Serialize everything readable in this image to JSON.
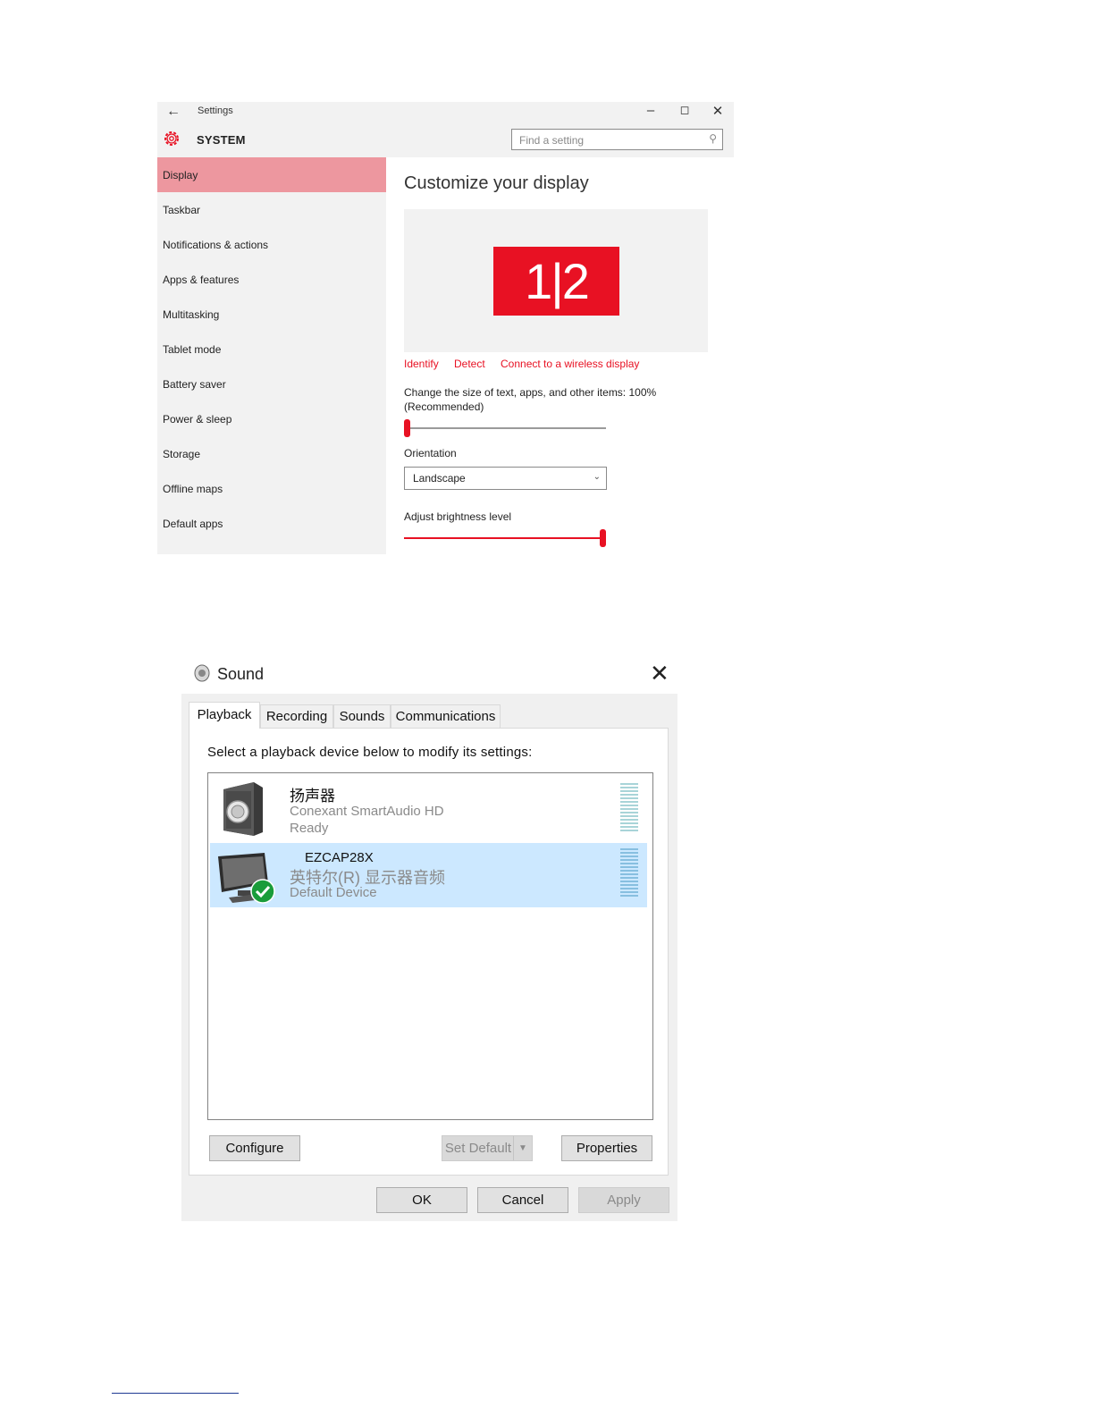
{
  "settings": {
    "window_title": "Settings",
    "section": "SYSTEM",
    "search_placeholder": "Find a setting",
    "nav": [
      {
        "label": "Display",
        "active": true
      },
      {
        "label": "Taskbar"
      },
      {
        "label": "Notifications & actions"
      },
      {
        "label": "Apps & features"
      },
      {
        "label": "Multitasking"
      },
      {
        "label": "Tablet mode"
      },
      {
        "label": "Battery saver"
      },
      {
        "label": "Power & sleep"
      },
      {
        "label": "Storage"
      },
      {
        "label": "Offline maps"
      },
      {
        "label": "Default apps"
      }
    ],
    "heading": "Customize your display",
    "monitor_label": "1|2",
    "links": {
      "identify": "Identify",
      "detect": "Detect",
      "wireless": "Connect to a wireless display"
    },
    "scale_text_1": "Change the size of text, apps, and other items: 100%",
    "scale_text_2": "(Recommended)",
    "scale_slider_value": 0,
    "orientation_label": "Orientation",
    "orientation_value": "Landscape",
    "brightness_label": "Adjust brightness level",
    "brightness_value": 1.0,
    "accent": "#e81123"
  },
  "sound": {
    "title": "Sound",
    "tabs": [
      "Playback",
      "Recording",
      "Sounds",
      "Communications"
    ],
    "active_tab": "Playback",
    "instruction": "Select a playback device below to modify its settings:",
    "devices": [
      {
        "name": "扬声器",
        "driver": "Conexant SmartAudio HD",
        "status": "Ready",
        "icon": "speaker-icon",
        "selected": false
      },
      {
        "name": "EZCAP28X",
        "driver": "英特尔(R) 显示器音频",
        "status": "Default Device",
        "icon": "monitor-icon",
        "selected": true,
        "default": true
      }
    ],
    "buttons": {
      "configure": "Configure",
      "set_default": "Set Default",
      "properties": "Properties",
      "ok": "OK",
      "cancel": "Cancel",
      "apply": "Apply"
    }
  }
}
